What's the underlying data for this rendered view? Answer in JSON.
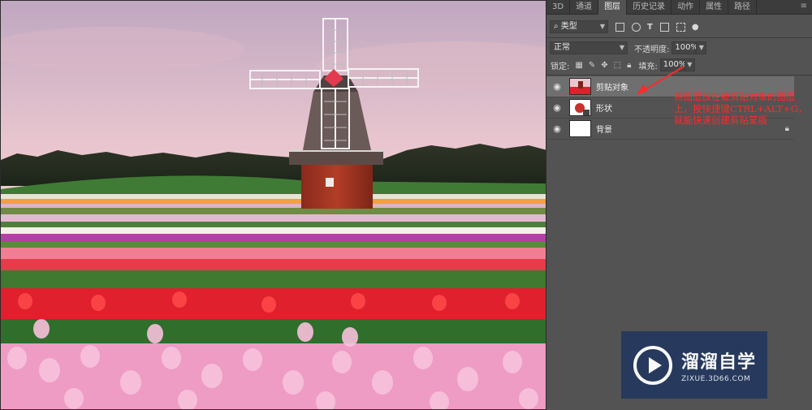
{
  "panel": {
    "tabs": [
      {
        "label": "3D",
        "active": false
      },
      {
        "label": "通道",
        "active": false
      },
      {
        "label": "图层",
        "active": true
      },
      {
        "label": "历史记录",
        "active": false
      },
      {
        "label": "动作",
        "active": false
      },
      {
        "label": "属性",
        "active": false
      },
      {
        "label": "路径",
        "active": false
      }
    ],
    "filter": {
      "label": "类型"
    },
    "blend_mode": "正常",
    "opacity": {
      "label": "不透明度:",
      "value": "100%"
    },
    "lock": {
      "label": "锁定:"
    },
    "fill": {
      "label": "填充:",
      "value": "100%"
    },
    "layers": [
      {
        "name": "剪贴对象",
        "selected": true
      },
      {
        "name": "形状",
        "selected": false
      },
      {
        "name": "背景",
        "selected": false
      }
    ]
  },
  "annotation": {
    "text": "将图层放在被剪贴对象的图层上，按快捷键CTRL+ALT+G，就能快速创建剪贴蒙版",
    "color": "#ff2a2a"
  },
  "watermark": {
    "title": "溜溜自学",
    "subtitle": "ZIXUE.3D66.COM"
  },
  "icons": [
    "eye-icon",
    "lock-icon",
    "pixel-filter-icon",
    "adjust-filter-icon",
    "type-filter-icon",
    "shape-filter-icon",
    "smart-filter-icon",
    "toggle-filter-icon",
    "brush-lock-icon",
    "move-lock-icon",
    "artboard-lock-icon"
  ]
}
